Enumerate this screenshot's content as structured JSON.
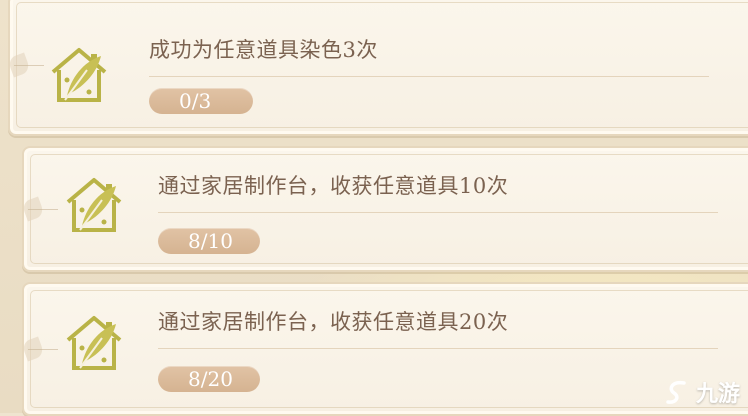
{
  "tasks": [
    {
      "title": "成功为任意道具染色3次",
      "progress": "0/3",
      "icon": "house-quill-icon"
    },
    {
      "title": "通过家居制作台，收获任意道具10次",
      "progress": "8/10",
      "icon": "house-quill-icon"
    },
    {
      "title": "通过家居制作台，收获任意道具20次",
      "progress": "8/20",
      "icon": "house-quill-icon"
    }
  ],
  "watermark": {
    "text": "九游",
    "icon": "jiuyou-logo-icon"
  },
  "colors": {
    "card_bg": "#fbf6ec",
    "title_text": "#7b6250",
    "pill_bg": "#d9b999",
    "icon_gold": "#b9b347"
  }
}
